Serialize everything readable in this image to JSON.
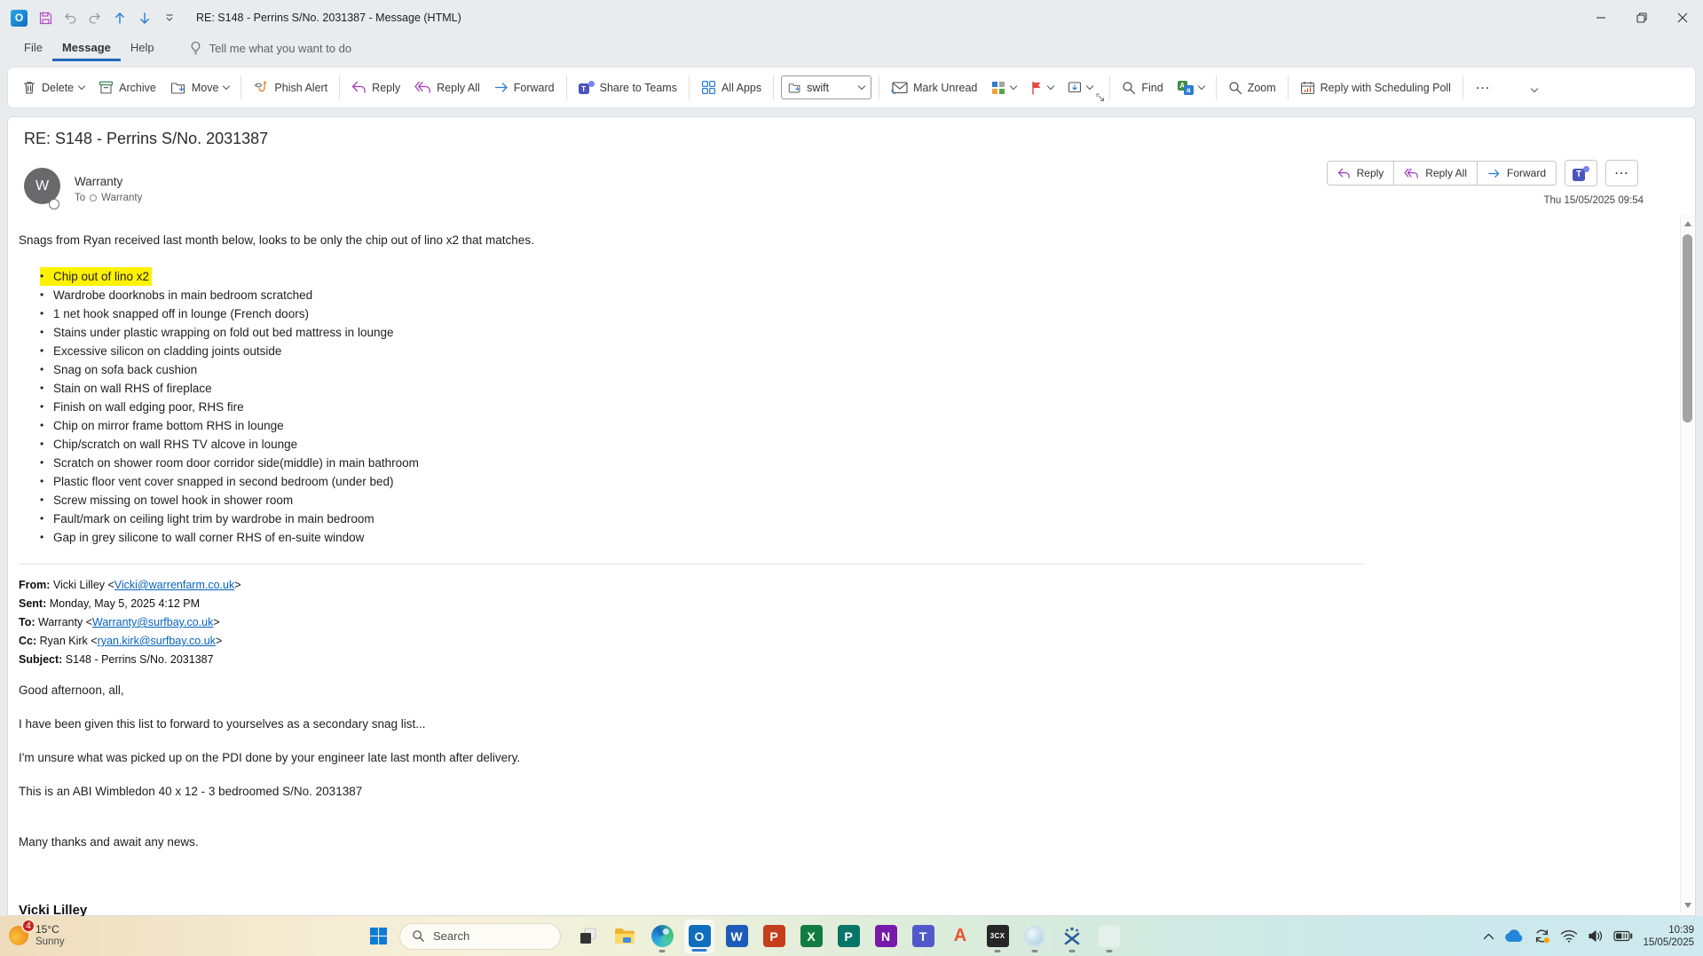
{
  "titlebar": {
    "title": "RE: S148 - Perrins S/No. 2031387  -  Message (HTML)"
  },
  "menubar": {
    "file": "File",
    "message": "Message",
    "help": "Help",
    "tell_me": "Tell me what you want to do"
  },
  "ribbon": {
    "delete": "Delete",
    "archive": "Archive",
    "move": "Move",
    "phish_alert": "Phish Alert",
    "reply": "Reply",
    "reply_all": "Reply All",
    "forward": "Forward",
    "share_to_teams": "Share to Teams",
    "all_apps": "All Apps",
    "swift": "swift",
    "mark_unread": "Mark Unread",
    "find": "Find",
    "zoom": "Zoom",
    "scheduling_poll": "Reply with Scheduling Poll",
    "more": "…"
  },
  "header": {
    "subject": "RE: S148 - Perrins S/No. 2031387",
    "avatar_initial": "W",
    "sender": "Warranty",
    "to_label": "To",
    "to_recipient": "Warranty",
    "reply": "Reply",
    "reply_all": "Reply All",
    "forward": "Forward",
    "more": "…",
    "timestamp": "Thu 15/05/2025 09:54"
  },
  "body": {
    "intro": "Snags from Ryan received last month below, looks to be only the chip out of lino x2 that matches.",
    "bullets": [
      "Chip out of lino x2",
      "Wardrobe doorknobs in main bedroom scratched",
      "1 net hook snapped off in lounge (French doors)",
      "Stains under plastic wrapping on fold out bed mattress in lounge",
      "Excessive silicon on cladding joints outside",
      "Snag on sofa back cushion",
      "Stain on wall RHS of fireplace",
      "Finish on wall edging poor, RHS fire",
      "Chip on mirror frame bottom RHS in lounge",
      "Chip/scratch on wall RHS TV alcove in lounge",
      "Scratch on shower room door corridor side(middle) in main bathroom",
      "Plastic floor vent cover snapped in second bedroom (under bed)",
      "Screw missing on towel hook in shower room",
      "Fault/mark on ceiling light trim by wardrobe in main bedroom",
      "Gap in grey silicone to wall corner RHS of en-suite window"
    ],
    "quoted": [
      {
        "label": "From:",
        "pre": " Vicki Lilley <",
        "link": "Vicki@warrenfarm.co.uk",
        "post": ">"
      },
      {
        "label": "Sent:",
        "pre": " Monday, May 5, 2025 4:12 PM",
        "link": "",
        "post": ""
      },
      {
        "label": "To:",
        "pre": " Warranty <",
        "link": "Warranty@surfbay.co.uk",
        "post": ">"
      },
      {
        "label": "Cc:",
        "pre": " Ryan Kirk <",
        "link": "ryan.kirk@surfbay.co.uk",
        "post": ">"
      },
      {
        "label": "Subject:",
        "pre": " S148 - Perrins S/No. 2031387",
        "link": "",
        "post": ""
      }
    ],
    "paragraphs": [
      "Good afternoon, all,",
      "I have been given this list to forward to yourselves as a secondary snag list...",
      "I'm unsure what was picked up on the PDI done by your engineer late last month after delivery.",
      "This is an ABI Wimbledon 40 x 12 - 3 bedroomed S/No. 2031387",
      "Many thanks and await any news."
    ],
    "signature": "Vicki Lilley"
  },
  "taskbar": {
    "weather_badge": "4",
    "weather_temp": "15°C",
    "weather_condition": "Sunny",
    "search": "Search",
    "tiles": {
      "outlook": "O",
      "word": "W",
      "powerpoint": "P",
      "excel": "X",
      "publisher": "P",
      "onenote": "N",
      "teams": "T",
      "a_app": "A",
      "threecx": "3CX"
    },
    "tray_time": "10:39",
    "tray_date": "15/05/2025"
  },
  "colors": {
    "accent": "#2368bd",
    "highlight": "#fff200",
    "link": "#0563c1",
    "flag_red": "#e8483f"
  }
}
